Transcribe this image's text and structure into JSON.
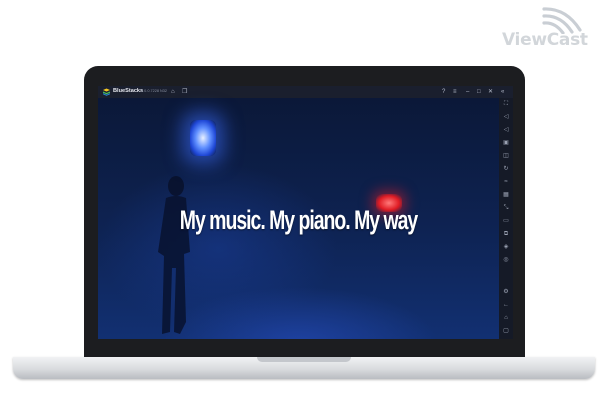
{
  "brand": {
    "logo_text": "ViewCast",
    "logo_icon": "wifi-arcs-icon"
  },
  "app": {
    "name": "BlueStacks",
    "version": "5.0.0.7228 N32"
  },
  "titlebar_icons": [
    "home-icon",
    "copy-icon",
    "help-icon",
    "menu-icon",
    "minimize-icon",
    "maximize-icon",
    "close-icon",
    "collapse-sidebar-icon"
  ],
  "sidebar_icons": [
    "fullscreen-icon",
    "volume-up-icon",
    "volume-down-icon",
    "media-icon",
    "screenshot-icon",
    "rotate-icon",
    "shake-icon",
    "macro-icon",
    "resize-icon",
    "folder-icon",
    "multi-instance-icon",
    "layers-icon",
    "eco-icon",
    "settings-icon",
    "back-icon",
    "home-icon",
    "recents-icon"
  ],
  "video": {
    "caption": "My music. My piano. My way"
  },
  "colors": {
    "screen_bg": "#0b1426",
    "accent_blue": "#2f5cff",
    "accent_red": "#e01c24"
  }
}
